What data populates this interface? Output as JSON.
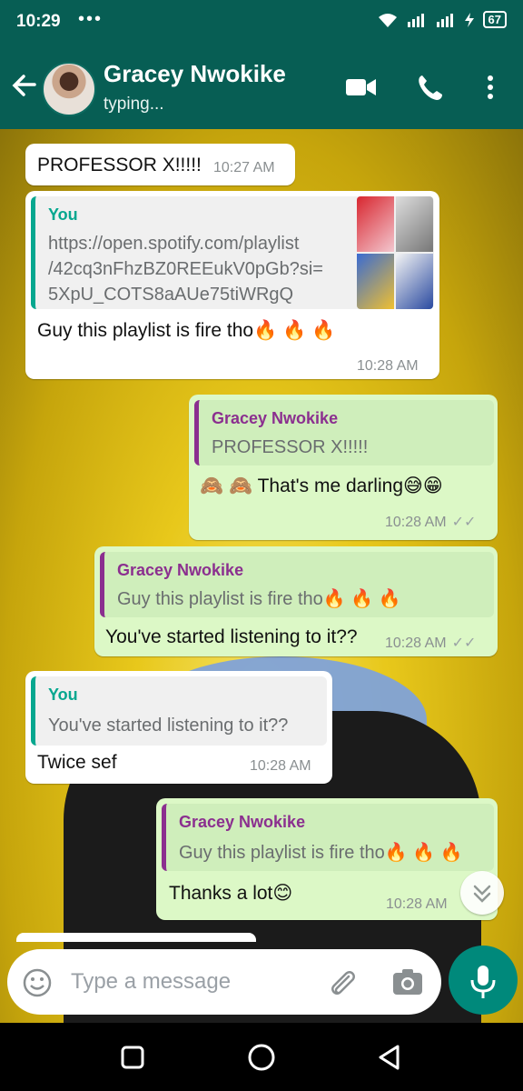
{
  "status_bar": {
    "time": "10:29",
    "dots": "•••",
    "battery": "67"
  },
  "header": {
    "contact_name": "Gracey Nwokike",
    "status": "typing..."
  },
  "messages": [
    {
      "direction": "incoming",
      "text": "PROFESSOR X!!!!!",
      "time": "10:27 AM"
    },
    {
      "direction": "incoming",
      "quote_author": "You",
      "quote_lines": [
        "https://open.spotify.com/playlist",
        "/42cq3nFhzBZ0REEukV0pGb?si=",
        "5XpU_COTS8aAUe75tiWRgQ"
      ],
      "text": "Guy this playlist is fire tho🔥 🔥 🔥",
      "time": "10:28 AM"
    },
    {
      "direction": "outgoing",
      "quote_author": "Gracey Nwokike",
      "quote_text": "PROFESSOR X!!!!!",
      "text": "🙈 🙈 That's me darling😅😁",
      "time": "10:28 AM"
    },
    {
      "direction": "outgoing",
      "quote_author": "Gracey Nwokike",
      "quote_text": "Guy this playlist is fire tho🔥 🔥 🔥",
      "text": "You've started listening to it??",
      "time": "10:28 AM"
    },
    {
      "direction": "incoming",
      "quote_author": "You",
      "quote_text": "You've started listening to it??",
      "text": "Twice sef",
      "time": "10:28 AM"
    },
    {
      "direction": "outgoing",
      "quote_author": "Gracey Nwokike",
      "quote_text": "Guy this playlist is fire tho🔥 🔥 🔥",
      "text": "Thanks a lot😊",
      "time": "10:28 AM"
    }
  ],
  "composer": {
    "placeholder": "Type a message"
  },
  "colors": {
    "header": "#075e54",
    "outgoing_bubble": "#dcf8c6",
    "incoming_bubble": "#ffffff",
    "mic_button": "#00897b"
  }
}
